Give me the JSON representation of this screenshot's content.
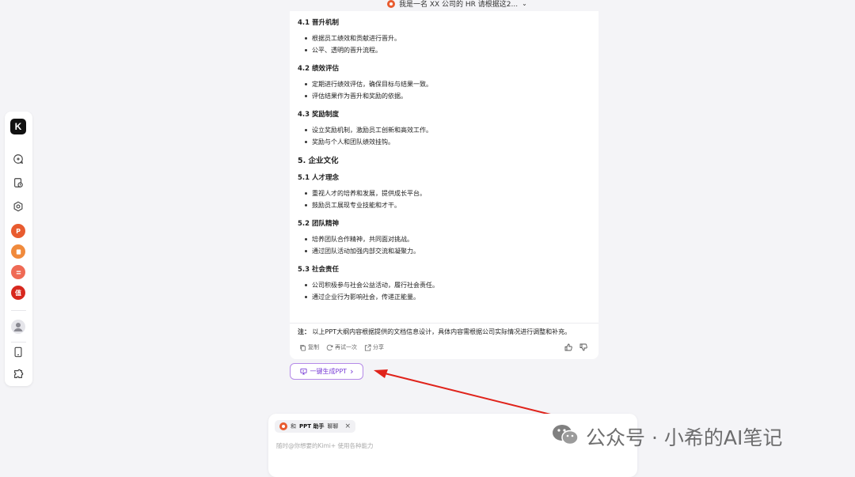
{
  "header": {
    "title": "我是一名 XX 公司的 HR 请根据这2..."
  },
  "sidebar": {
    "logo": "K",
    "apps": [
      {
        "name": "ppt-assistant",
        "glyph": "P",
        "color": "#e85b2f"
      },
      {
        "name": "orange-app",
        "glyph": "",
        "color": "#f08a3c"
      },
      {
        "name": "coral-app",
        "glyph": "",
        "color": "#ef6a55"
      },
      {
        "name": "zhi-app",
        "glyph": "值",
        "color": "#d7281e"
      }
    ]
  },
  "content": {
    "sections": [
      {
        "heading": "4.1 晋升机制",
        "bullets": [
          "根据员工绩效和贡献进行晋升。",
          "公平、透明的晋升流程。"
        ]
      },
      {
        "heading": "4.2 绩效评估",
        "bullets": [
          "定期进行绩效评估，确保目标与结果一致。",
          "评估结果作为晋升和奖励的依据。"
        ]
      },
      {
        "heading": "4.3 奖励制度",
        "bullets": [
          "设立奖励机制，激励员工创新和高效工作。",
          "奖励与个人和团队绩效挂钩。"
        ]
      },
      {
        "heading": "5. 企业文化",
        "bullets": []
      },
      {
        "heading": "5.1 人才理念",
        "bullets": [
          "重视人才的培养和发展，提供成长平台。",
          "鼓励员工展现专业技能和才干。"
        ]
      },
      {
        "heading": "5.2 团队精神",
        "bullets": [
          "培养团队合作精神，共同面对挑战。",
          "通过团队活动加强内部交流和凝聚力。"
        ]
      },
      {
        "heading": "5.3 社会责任",
        "bullets": [
          "公司积极参与社会公益活动，履行社会责任。",
          "通过企业行为影响社会，传递正能量。"
        ]
      }
    ],
    "note_label": "注：",
    "note_text": "以上PPT大纲内容根据提供的文档信息设计，具体内容需根据公司实际情况进行调整和补充。"
  },
  "actions": {
    "copy": "复制",
    "retry": "再试一次",
    "share": "分享"
  },
  "generate_button": {
    "label": "一键生成PPT",
    "chevron": "›"
  },
  "input": {
    "chip_prefix": "和",
    "chip_name": "PPT 助手",
    "chip_suffix": "聊聊",
    "chip_close": "×",
    "placeholder": "随时@你想要的Kimi+ 使用各种能力"
  },
  "watermark": {
    "text": "公众号 · 小希的AI笔记"
  },
  "colors": {
    "accent": "#7a3ed6",
    "arrow": "#e0231b"
  }
}
